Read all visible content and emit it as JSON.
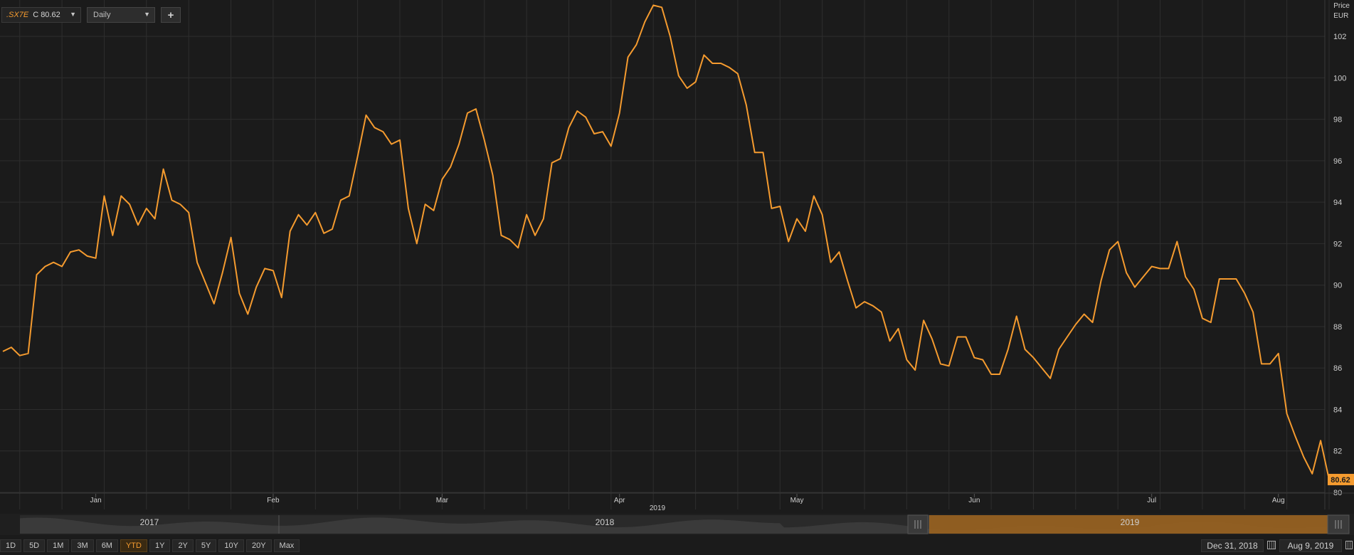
{
  "toolbar": {
    "ticker_symbol": ".SX7E",
    "ticker_close": "C 80.62",
    "interval": "Daily",
    "add_label": "+"
  },
  "axis_unit": {
    "line1": "Price",
    "line2": "EUR"
  },
  "last_price_label": "80.62",
  "range_buttons": [
    "1D",
    "5D",
    "1M",
    "3M",
    "6M",
    "YTD",
    "1Y",
    "2Y",
    "5Y",
    "10Y",
    "20Y",
    "Max"
  ],
  "active_range": "YTD",
  "date_from": "Dec 31, 2018",
  "date_to": "Aug 9, 2019",
  "navigator": {
    "years": [
      "2017",
      "2018",
      "2019"
    ]
  },
  "colors": {
    "line": "#f59b2f",
    "background": "#1b1b1b",
    "grid": "#2e2e2e",
    "navigator_selected": "#9a6320"
  },
  "chart_data": {
    "type": "line",
    "series_color": "#f59b2f",
    "ylim": [
      80,
      103
    ],
    "y_ticks": [
      80,
      82,
      84,
      86,
      88,
      90,
      92,
      94,
      96,
      98,
      100,
      102
    ],
    "x_axis_year": "2019",
    "x_month_labels": [
      {
        "label": "Jan",
        "index": 11
      },
      {
        "label": "Feb",
        "index": 32
      },
      {
        "label": "Mar",
        "index": 52
      },
      {
        "label": "Apr",
        "index": 73
      },
      {
        "label": "May",
        "index": 94
      },
      {
        "label": "Jun",
        "index": 115
      },
      {
        "label": "Jul",
        "index": 136
      },
      {
        "label": "Aug",
        "index": 151
      }
    ],
    "values": [
      86.8,
      87.0,
      86.6,
      86.7,
      90.5,
      90.9,
      91.1,
      90.9,
      91.6,
      91.7,
      91.4,
      91.3,
      94.3,
      92.4,
      94.3,
      93.9,
      92.9,
      93.7,
      93.2,
      95.6,
      94.1,
      93.9,
      93.5,
      91.1,
      90.1,
      89.1,
      90.6,
      92.3,
      89.6,
      88.6,
      89.9,
      90.8,
      90.7,
      89.4,
      92.6,
      93.4,
      92.9,
      93.5,
      92.5,
      92.7,
      94.1,
      94.3,
      96.2,
      98.2,
      97.6,
      97.4,
      96.8,
      97.0,
      93.7,
      92.0,
      93.9,
      93.6,
      95.1,
      95.7,
      96.8,
      98.3,
      98.5,
      97.0,
      95.3,
      92.4,
      92.2,
      91.8,
      93.4,
      92.4,
      93.2,
      95.9,
      96.1,
      97.6,
      98.4,
      98.1,
      97.3,
      97.4,
      96.7,
      98.3,
      101.0,
      101.6,
      102.7,
      103.5,
      103.4,
      102.0,
      100.1,
      99.5,
      99.8,
      101.1,
      100.7,
      100.7,
      100.5,
      100.2,
      98.7,
      96.4,
      96.4,
      93.7,
      93.8,
      92.1,
      93.2,
      92.6,
      94.3,
      93.4,
      91.1,
      91.6,
      90.2,
      88.9,
      89.2,
      89.0,
      88.7,
      87.3,
      87.9,
      86.4,
      85.9,
      88.3,
      87.4,
      86.2,
      86.1,
      87.5,
      87.5,
      86.5,
      86.4,
      85.7,
      85.7,
      86.9,
      88.5,
      86.9,
      86.5,
      86.0,
      85.5,
      86.9,
      87.5,
      88.1,
      88.6,
      88.2,
      90.2,
      91.7,
      92.1,
      90.6,
      89.9,
      90.4,
      90.9,
      90.8,
      90.8,
      92.1,
      90.4,
      89.8,
      88.4,
      88.2,
      90.3,
      90.3,
      90.3,
      89.6,
      88.7,
      86.2,
      86.2,
      86.7,
      83.8,
      82.7,
      81.7,
      80.9,
      82.5,
      80.62
    ]
  }
}
